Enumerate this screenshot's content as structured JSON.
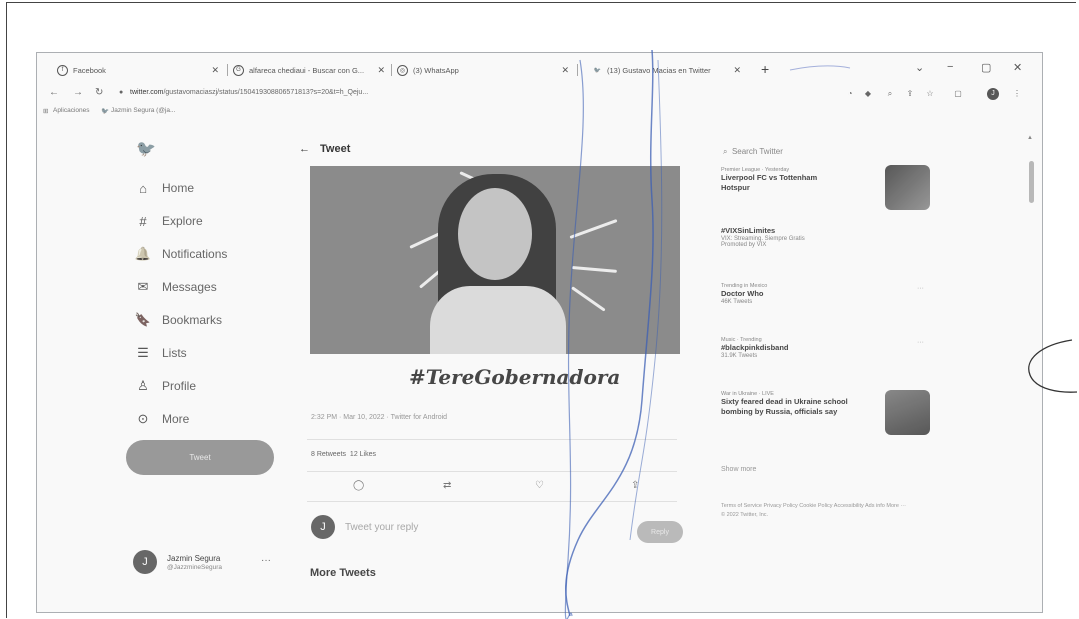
{
  "browser": {
    "tabs": [
      {
        "label": "Facebook",
        "icon": "facebook-icon"
      },
      {
        "label": "alfareca chediaui - Buscar con G...",
        "icon": "google-icon"
      },
      {
        "label": "(3) WhatsApp",
        "icon": "whatsapp-icon"
      },
      {
        "label": "(13) Gustavo Macias en Twitter",
        "icon": "twitter-icon"
      }
    ],
    "url_host": "twitter.com",
    "url_path": "/gustavomaciaszj/status/150419308806571813?s=20&t=h_Qeju...",
    "bookmarks": [
      "Aplicaciones",
      "Jazmin Segura (@ja..."
    ]
  },
  "nav": {
    "items": [
      {
        "label": "Home",
        "icon": "home-icon"
      },
      {
        "label": "Explore",
        "icon": "hashtag-icon"
      },
      {
        "label": "Notifications",
        "icon": "bell-icon"
      },
      {
        "label": "Messages",
        "icon": "envelope-icon"
      },
      {
        "label": "Bookmarks",
        "icon": "bookmark-icon"
      },
      {
        "label": "Lists",
        "icon": "list-icon"
      },
      {
        "label": "Profile",
        "icon": "person-icon"
      },
      {
        "label": "More",
        "icon": "more-circle-icon"
      }
    ],
    "tweet_button": "Tweet",
    "account": {
      "initial": "J",
      "name": "Jazmin Segura",
      "handle": "@JazzmineSegura"
    }
  },
  "tweet": {
    "header": "Tweet",
    "hashtag": "#TereGobernadora",
    "meta": "2:32 PM · Mar 10, 2022 · Twitter for Android",
    "retweets": "8 Retweets",
    "likes": "12 Likes",
    "reply_placeholder": "Tweet your reply",
    "reply_button": "Reply",
    "reply_avatar": "J",
    "more_tweets": "More Tweets"
  },
  "sidebar": {
    "search_placeholder": "Search Twitter",
    "trends": [
      {
        "context": "Premier League · Yesterday",
        "title": "Liverpool FC vs Tottenham Hotspur",
        "sub": ""
      },
      {
        "context": "",
        "title": "#VIXSinLimites",
        "sub": "VIX: Streaming. Siempre Gratis",
        "sub2": "Promoted by VIX"
      },
      {
        "context": "Trending in Mexico",
        "title": "Doctor Who",
        "sub": "46K Tweets"
      },
      {
        "context": "Music · Trending",
        "title": "#blackpinkdisband",
        "sub": "31.9K Tweets"
      },
      {
        "context": "War in Ukraine · LIVE",
        "title": "Sixty feared dead in Ukraine school bombing by Russia, officials say",
        "sub": ""
      }
    ],
    "show_more": "Show more",
    "footer": "Terms of Service  Privacy Policy  Cookie Policy  Accessibility  Ads info  More ···  © 2022 Twitter, Inc."
  }
}
